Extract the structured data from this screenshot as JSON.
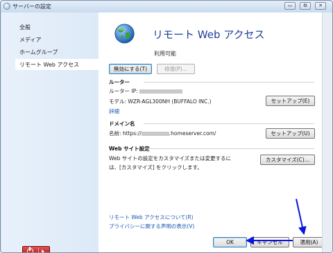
{
  "window": {
    "title": "サーバーの設定",
    "controls": {
      "minimize": "▭",
      "maximize": "⧉",
      "close": "✕"
    }
  },
  "sidebar": {
    "items": [
      {
        "label": "全般"
      },
      {
        "label": "メディア"
      },
      {
        "label": "ホームグループ"
      },
      {
        "label": "リモート Web アクセス",
        "selected": true
      }
    ]
  },
  "main": {
    "heading": "リモート Web アクセス",
    "status": "利用可能",
    "disable_button": "無効にする(T)",
    "repair_button": "修復(P)...",
    "router": {
      "title": "ルーター",
      "ip_label": "ルーター IP:",
      "model_label": "モデル: WZR-AGL300NH (BUFFALO INC.)",
      "details_link": "詳細",
      "setup_button": "セットアップ(E)"
    },
    "domain": {
      "title": "ドメイン名",
      "name_prefix": "名前: https://",
      "name_suffix": ".homeserver.com/",
      "setup_button": "セットアップ(U)"
    },
    "website": {
      "title": "Web サイト設定",
      "desc_line1": "Web サイトの設定をカスタマイズまたは変更するに",
      "desc_line2": "は、[カスタマイズ] をクリックします。",
      "customize_button": "カスタマイズ(C)..."
    },
    "links": {
      "about": "リモート Web アクセスについて(R)",
      "privacy": "プライバシーに関する声明の表示(V)"
    }
  },
  "footer": {
    "ok_button": "OK",
    "cancel_button": "キャンセル",
    "apply_button": "適用(A)"
  },
  "colors": {
    "heading": "#1e3f99",
    "link": "#1a55b0",
    "annotation_arrow": "#0a14e0",
    "power_button": "#c21a1a"
  }
}
